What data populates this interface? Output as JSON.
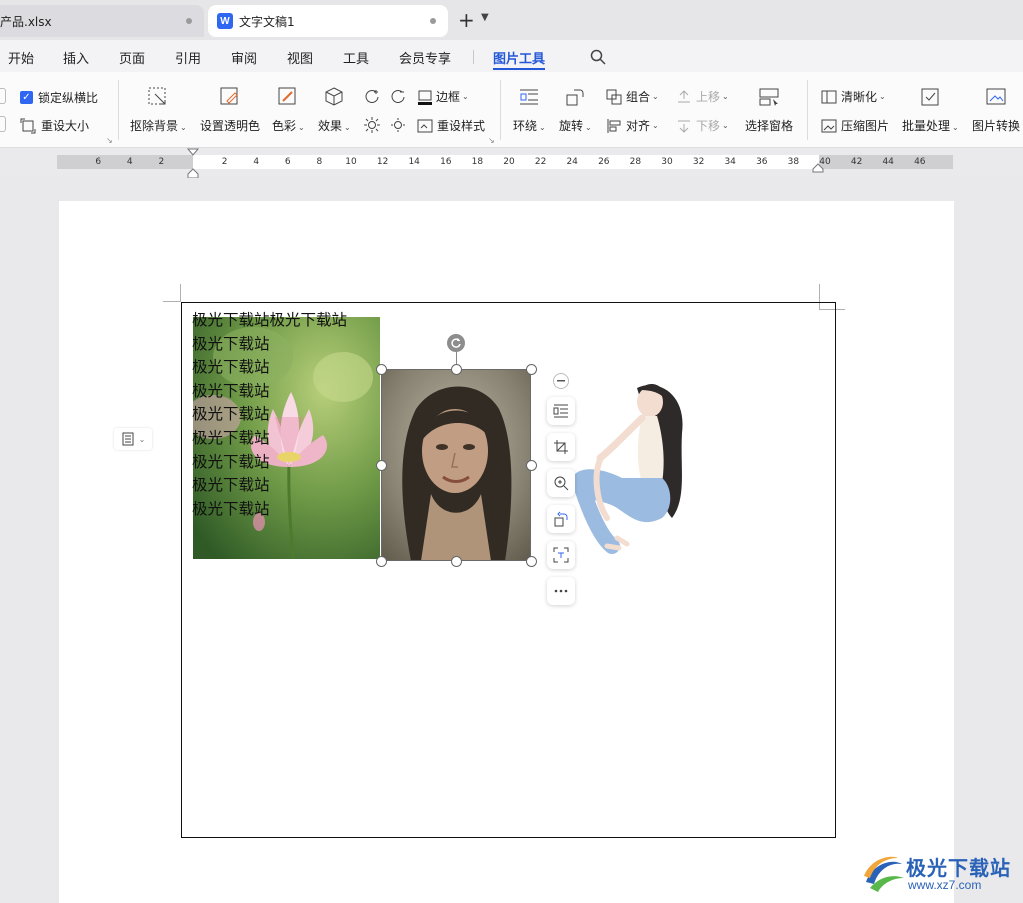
{
  "tabs": [
    {
      "label": "产品.xlsx",
      "active": false
    },
    {
      "label": "文字文稿1",
      "active": true,
      "icon": "W"
    }
  ],
  "tab_add": "+",
  "tab_more": "⌄",
  "menu": [
    "开始",
    "插入",
    "页面",
    "引用",
    "审阅",
    "视图",
    "工具",
    "会员专享",
    "图片工具"
  ],
  "menu_active": "图片工具",
  "ribbon": {
    "lock_ratio": "锁定纵横比",
    "reset_size": "重设大小",
    "remove_bg": "抠除背景",
    "set_transparent": "设置透明色",
    "color": "色彩",
    "effect": "效果",
    "border": "边框",
    "reset_style": "重设样式",
    "wrap": "环绕",
    "rotate": "旋转",
    "group": "组合",
    "align": "对齐",
    "move_up": "上移",
    "move_down": "下移",
    "select_pane": "选择窗格",
    "sharpen": "清晰化",
    "compress": "压缩图片",
    "batch": "批量处理",
    "convert": "图片转换"
  },
  "ruler_ticks": [
    "6",
    "4",
    "2",
    "2",
    "4",
    "6",
    "8",
    "10",
    "12",
    "14",
    "16",
    "18",
    "20",
    "22",
    "24",
    "26",
    "28",
    "30",
    "32",
    "34",
    "36",
    "38",
    "40",
    "42",
    "44",
    "46"
  ],
  "document": {
    "lines": [
      "极光下载站极光下载站",
      "极光下载站",
      "极光下载站",
      "极光下载站",
      "极光下载站",
      "极光下载站",
      "极光下载站",
      "极光下载站",
      "极光下载站"
    ]
  },
  "watermark": {
    "title": "极光下载站",
    "url": "www.xz7.com"
  },
  "colors": {
    "accent": "#2558d8",
    "wps_blue": "#2f66f2"
  }
}
